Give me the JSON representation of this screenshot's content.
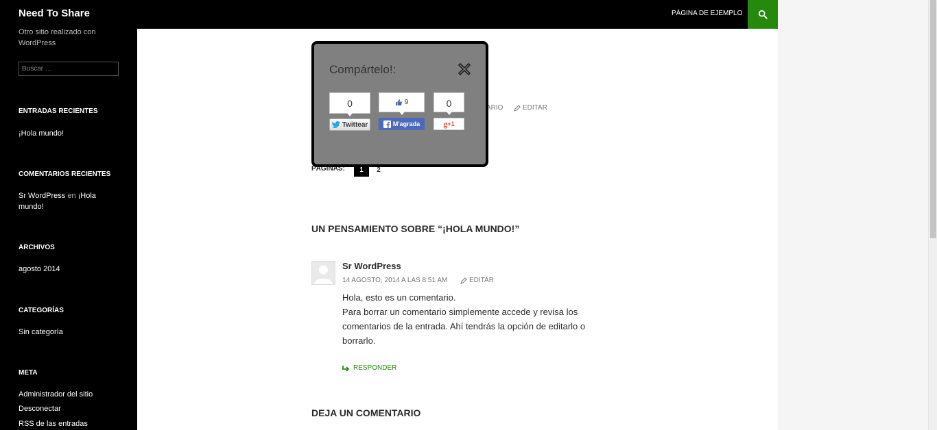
{
  "header": {
    "site_title": "Need To Share",
    "nav_link": "PÁGINA DE EJEMPLO",
    "search_icon": "search-icon",
    "accent": "#24890d"
  },
  "sidebar": {
    "tagline": "Otro sitio realizado con WordPress",
    "search_placeholder": "Buscar …",
    "recent_posts": {
      "title": "ENTRADAS RECIENTES",
      "items": [
        "¡Hola mundo!"
      ]
    },
    "recent_comments": {
      "title": "COMENTARIOS RECIENTES",
      "author": "Sr WordPress",
      "connector": "en",
      "post": "¡Hola mundo!"
    },
    "archives": {
      "title": "ARCHIVOS",
      "items": [
        "agosto 2014"
      ]
    },
    "categories": {
      "title": "CATEGORÍAS",
      "items": [
        "Sin categoría"
      ]
    },
    "meta": {
      "title": "META",
      "items": [
        "Administrador del sitio",
        "Desconectar",
        "RSS de las entradas"
      ]
    }
  },
  "post_meta": {
    "partial": "ARIO",
    "edit": "EDITAR"
  },
  "pagination": {
    "label": "PÁGINAS:",
    "pages": [
      "1",
      "2"
    ],
    "current": "1"
  },
  "comments": {
    "title": "UN PENSAMIENTO SOBRE “¡HOLA MUNDO!”",
    "items": [
      {
        "author": "Sr WordPress",
        "date": "14 AGOSTO, 2014 A LAS 8:51 AM",
        "edit": "EDITAR",
        "body": [
          "Hola, esto es un comentario.",
          "Para borrar un comentario simplemente accede y revisa los comentarios de la entrada. Ahí tendrás la opción de editarlo o borrarlo."
        ],
        "reply": "RESPONDER"
      }
    ],
    "leave_title": "DEJA UN COMENTARIO"
  },
  "share_popup": {
    "title": "Compártelo!:",
    "close_icon": "close-icon",
    "twitter": {
      "count": "0",
      "label": "Twittear"
    },
    "facebook": {
      "count": "9",
      "label": "M'agrada"
    },
    "google": {
      "count": "0",
      "label": "+1"
    }
  }
}
